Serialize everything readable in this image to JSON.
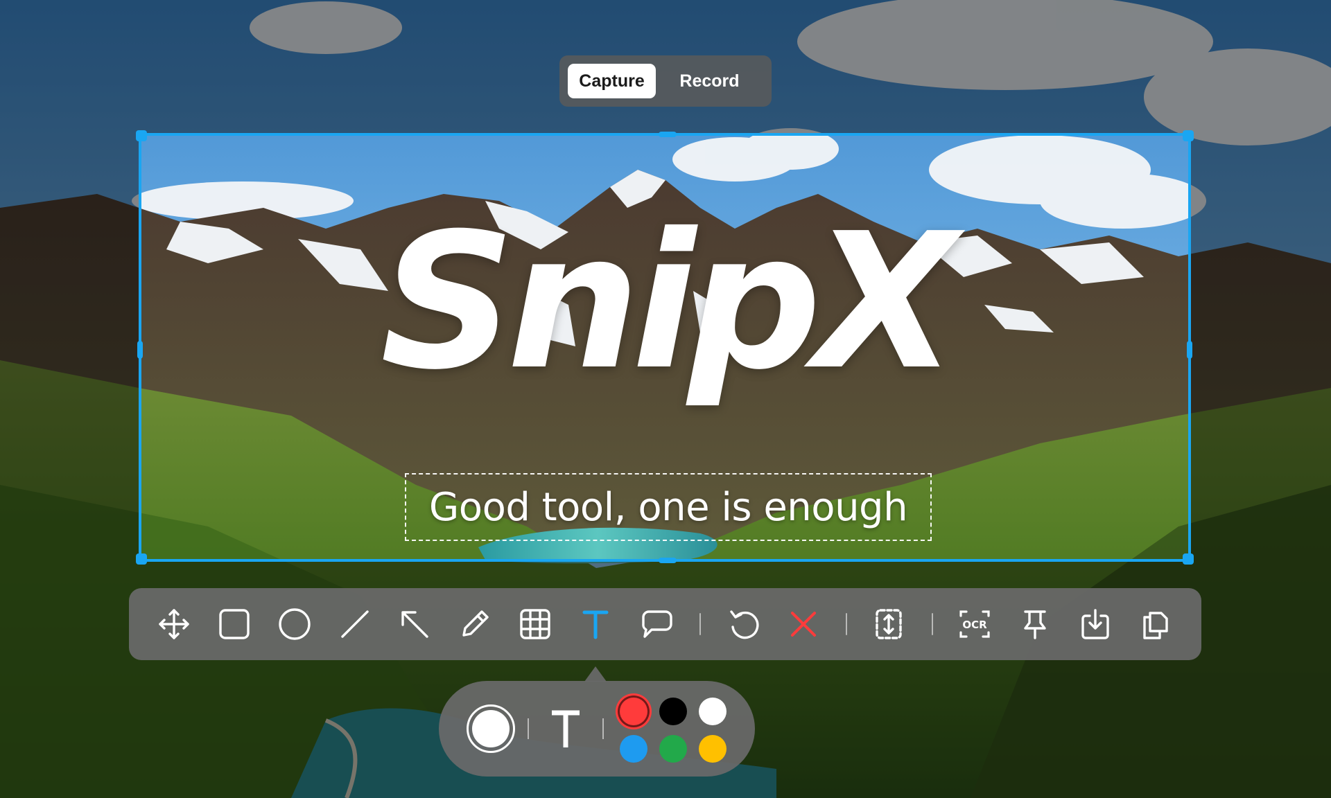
{
  "mode_switch": {
    "capture_label": "Capture",
    "record_label": "Record",
    "active": "capture"
  },
  "canvas": {
    "brand_text": "SnipX",
    "tagline": "Good tool, one is enough"
  },
  "colors": {
    "accent": "#1aa6f2",
    "active_tool": "#1aa6f2",
    "delete": "#ff3b3b",
    "toolbar_bg": "#696969"
  },
  "toolbar": {
    "tools": [
      {
        "name": "move-icon",
        "active": false
      },
      {
        "name": "rectangle-icon",
        "active": false
      },
      {
        "name": "ellipse-icon",
        "active": false
      },
      {
        "name": "line-icon",
        "active": false
      },
      {
        "name": "arrow-icon",
        "active": false
      },
      {
        "name": "pencil-icon",
        "active": false
      },
      {
        "name": "mosaic-icon",
        "active": false
      },
      {
        "name": "text-icon",
        "active": true
      },
      {
        "name": "callout-icon",
        "active": false
      },
      {
        "name": "undo-icon",
        "active": false
      },
      {
        "name": "close-icon",
        "active": false
      },
      {
        "name": "scroll-capture-icon",
        "active": false
      },
      {
        "name": "ocr-icon",
        "active": false
      },
      {
        "name": "pin-icon",
        "active": false
      },
      {
        "name": "download-icon",
        "active": false
      },
      {
        "name": "copy-icon",
        "active": false
      }
    ],
    "ocr_label": "OCR"
  },
  "text_options": {
    "font_glyph": "T",
    "stroke_size": "large",
    "selected_color": "#ff3b3b",
    "palette": [
      "#ff3b3b",
      "#000000",
      "#ffffff",
      "#1e9bf0",
      "#22a94a",
      "#ffc000"
    ]
  }
}
